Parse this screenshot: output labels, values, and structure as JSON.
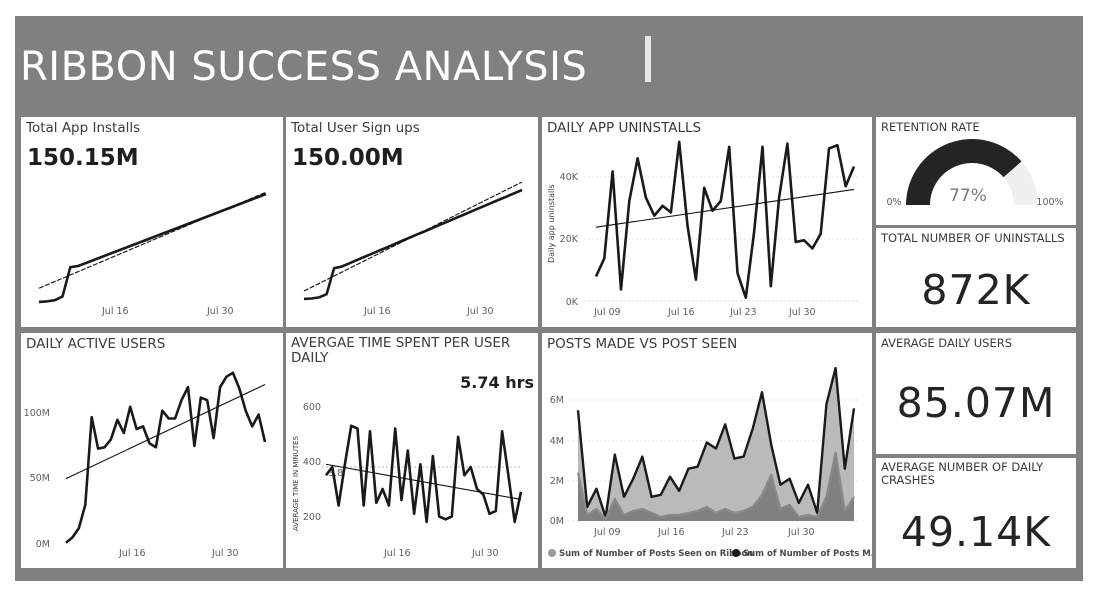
{
  "header": {
    "title": "RIBBON SUCCESS ANALYSIS"
  },
  "installs": {
    "title": "Total App Installs",
    "value": "150.15M",
    "x_ticks": [
      "Jul 16",
      "Jul 30"
    ]
  },
  "signups": {
    "title": "Total User Sign ups",
    "value": "150.00M",
    "x_ticks": [
      "Jul 16",
      "Jul 30"
    ]
  },
  "uninstalls_chart": {
    "title": "DAILY APP UNINSTALLS",
    "ylabel": "Daily app uninstalls",
    "y_ticks": [
      "40K",
      "20K",
      "0K"
    ],
    "x_ticks": [
      "Jul 09",
      "Jul 16",
      "Jul 23",
      "Jul 30"
    ]
  },
  "retention": {
    "title": "RETENTION RATE",
    "value": "77%",
    "min": "0%",
    "max": "100%",
    "fraction": 0.77
  },
  "total_uninstalls": {
    "title": "TOTAL NUMBER OF UNINSTALLS",
    "value": "872K"
  },
  "dau": {
    "title": "DAILY ACTIVE USERS",
    "y_ticks": [
      "100M",
      "50M",
      "0M"
    ],
    "x_ticks": [
      "Jul 16",
      "Jul 30"
    ]
  },
  "time_spent": {
    "title": "AVERGAE TIME SPENT PER USER DAILY",
    "value": "5.74 hrs",
    "ylabel": "AVERAGE TIME IN MINUTES",
    "y_ticks": [
      "600",
      "400",
      "200"
    ],
    "ref_label": "3.8",
    "x_ticks": [
      "Jul 16",
      "Jul 30"
    ]
  },
  "posts": {
    "title": "POSTS MADE VS POST SEEN",
    "y_ticks": [
      "6M",
      "4M",
      "2M",
      "0M"
    ],
    "x_ticks": [
      "Jul 09",
      "Jul 16",
      "Jul 23",
      "Jul 30"
    ],
    "legend_seen": "Sum of Number of Posts Seen on Ribbon",
    "legend_made": "Sum of Number of Posts M..."
  },
  "avg_daily_users": {
    "title": "AVERAGE DAILY USERS",
    "value": "85.07M"
  },
  "avg_crashes": {
    "title": "AVERAGE NUMBER OF DAILY CRASHES",
    "value": "49.14K"
  },
  "colors": {
    "background": "#808080",
    "line": "#1a1a1a",
    "gauge_fill": "#252423",
    "gauge_track": "#f0f0f0",
    "area_seen": "#b3b3b3",
    "area_made": "#7a7a7a"
  },
  "chart_data": [
    {
      "id": "installs",
      "type": "line",
      "title": "Total App Installs",
      "x_ticks": [
        "Jul 16",
        "Jul 30"
      ],
      "series": [
        {
          "values": [
            0.02,
            0.1,
            0.3,
            0.9,
            5.8,
            6.0,
            6.5,
            7.0,
            7.5,
            8.0,
            8.5,
            9.0,
            9.5,
            10.0,
            10.5,
            11.0,
            11.5,
            12.0,
            12.5,
            13.0,
            13.5,
            14.0,
            14.5,
            15.0,
            15.5,
            16.0,
            16.5,
            17.0,
            17.5,
            18.0
          ]
        }
      ],
      "trend": [
        2.3,
        18.3
      ]
    },
    {
      "id": "signups",
      "type": "line",
      "title": "Total User Sign ups",
      "x_ticks": [
        "Jul 16",
        "Jul 30"
      ],
      "series": [
        {
          "values": [
            0.02,
            0.1,
            0.3,
            0.9,
            5.8,
            6.1,
            6.7,
            7.3,
            7.9,
            8.5,
            9.1,
            9.7,
            10.3,
            10.9,
            11.5,
            12.1,
            12.7,
            13.3,
            13.9,
            14.5,
            15.1,
            15.7,
            16.3,
            16.9,
            17.5,
            18.1,
            18.7,
            19.3,
            19.9,
            20.5
          ]
        }
      ],
      "trend": [
        1.5,
        22.0
      ]
    },
    {
      "id": "uninstalls",
      "type": "line",
      "title": "DAILY APP UNINSTALLS",
      "ylabel": "Daily app uninstalls",
      "ylim": [
        0,
        50000
      ],
      "x_ticks": [
        "Jul 09",
        "Jul 16",
        "Jul 23",
        "Jul 30"
      ],
      "series": [
        {
          "values": [
            7500,
            13000,
            39500,
            3500,
            30500,
            43500,
            31500,
            26000,
            29000,
            27000,
            48500,
            23000,
            6500,
            34500,
            27500,
            30500,
            47000,
            8500,
            1000,
            21000,
            47000,
            4500,
            31500,
            48000,
            18000,
            18500,
            16000,
            20500,
            46500,
            47500,
            35000,
            41000
          ]
        }
      ],
      "trend": [
        22500,
        34000
      ]
    },
    {
      "id": "dau",
      "type": "line",
      "title": "DAILY ACTIVE USERS",
      "ylim": [
        0,
        140
      ],
      "y_ticks": [
        "100M",
        "50M",
        "0M"
      ],
      "x_ticks": [
        "Jul 16",
        "Jul 30"
      ],
      "series": [
        {
          "values": [
            1,
            5,
            12,
            30,
            97,
            73,
            74,
            80,
            95,
            85,
            105,
            88,
            90,
            77,
            74,
            102,
            96,
            96,
            110,
            120,
            75,
            112,
            110,
            81,
            120,
            128,
            131,
            119,
            102,
            90,
            99,
            78
          ]
        }
      ],
      "trend": [
        50,
        122
      ]
    },
    {
      "id": "time_spent",
      "type": "line",
      "title": "AVERGAE TIME SPENT PER USER DAILY",
      "ylabel": "AVERAGE TIME IN MINUTES",
      "ylim": [
        100,
        700
      ],
      "y_ticks": [
        "600",
        "400",
        "200"
      ],
      "x_ticks": [
        "Jul 16",
        "Jul 30"
      ],
      "series": [
        {
          "values": [
            350,
            380,
            240,
            390,
            530,
            520,
            240,
            510,
            250,
            300,
            240,
            520,
            260,
            440,
            210,
            390,
            180,
            420,
            200,
            190,
            200,
            490,
            350,
            380,
            300,
            280,
            210,
            220,
            510,
            350,
            180,
            290
          ]
        }
      ],
      "trend": [
        390,
        262
      ],
      "reference_line": 380
    },
    {
      "id": "posts",
      "type": "area",
      "title": "POSTS MADE VS POST SEEN",
      "ylim": [
        0,
        8
      ],
      "y_ticks": [
        "6M",
        "4M",
        "2M",
        "0M"
      ],
      "x_ticks": [
        "Jul 09",
        "Jul 16",
        "Jul 23",
        "Jul 30"
      ],
      "series": [
        {
          "name": "Sum of Number of Posts Seen on Ribbon",
          "values": [
            5.5,
            0.7,
            1.6,
            0.2,
            3.3,
            1.2,
            2.1,
            3.2,
            1.2,
            1.3,
            2.2,
            1.5,
            2.6,
            2.7,
            3.9,
            3.6,
            4.8,
            3.1,
            3.2,
            4.6,
            6.4,
            3.8,
            1.8,
            2.1,
            0.9,
            1.8,
            0.4,
            5.8,
            7.6,
            2.6,
            5.6
          ]
        },
        {
          "name": "Sum of Number of Posts M...",
          "values": [
            2.4,
            0.3,
            0.6,
            0.1,
            1.1,
            0.3,
            0.5,
            0.6,
            0.4,
            0.2,
            0.3,
            0.3,
            0.4,
            0.5,
            0.7,
            0.4,
            0.6,
            0.4,
            0.5,
            0.7,
            1.3,
            2.3,
            0.6,
            0.8,
            0.2,
            0.3,
            0.2,
            1.2,
            3.4,
            0.5,
            1.2
          ]
        }
      ]
    }
  ]
}
